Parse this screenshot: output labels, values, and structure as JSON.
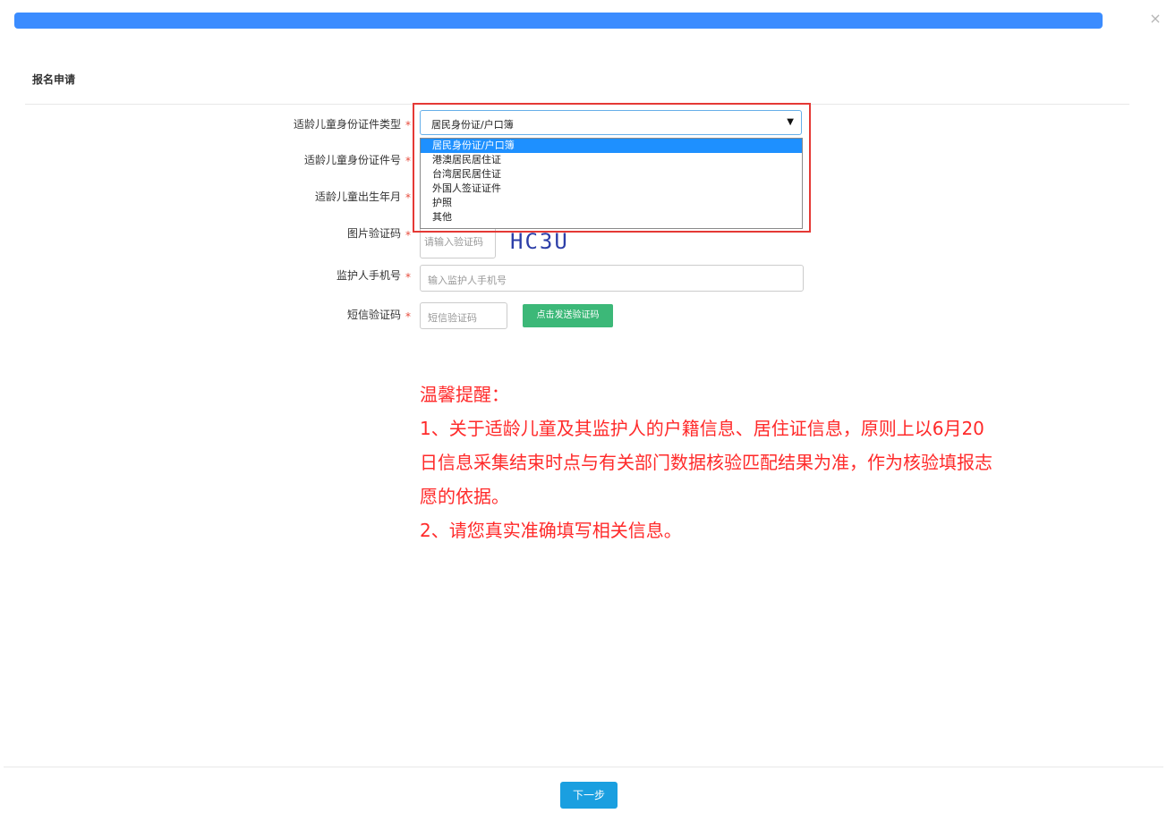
{
  "modal": {
    "close_glyph": "×",
    "progress_percent": 100,
    "accent_color": "#3b8cff"
  },
  "page_title": "报名申请",
  "form": {
    "id_type_label": "适龄儿童身份证件类型",
    "id_type_selected": "居民身份证/户口簿",
    "id_type_options": [
      "居民身份证/户口簿",
      "港澳居民居住证",
      "台湾居民居住证",
      "外国人签证证件",
      "护照",
      "其他"
    ],
    "id_number_label": "适龄儿童身份证件号",
    "birth_label": "适龄儿童出生年月",
    "captcha_label": "图片验证码",
    "captcha_placeholder": "请输入验证码",
    "captcha_image_text": "HC3U",
    "guardian_phone_label": "监护人手机号",
    "guardian_phone_placeholder": "输入监护人手机号",
    "sms_label": "短信验证码",
    "sms_placeholder": "短信验证码",
    "send_code_button": "点击发送验证码",
    "required_mark": "*"
  },
  "notice": {
    "title": "温馨提醒：",
    "line1": "1、关于适龄儿童及其监护人的户籍信息、居住证信息，原则上以6月20日信息采集结束时点与有关部门数据核验匹配结果为准，作为核验填报志愿的依据。",
    "line2": "2、请您真实准确填写相关信息。",
    "color": "#ff2a2a"
  },
  "footer": {
    "next_button": "下一步"
  }
}
